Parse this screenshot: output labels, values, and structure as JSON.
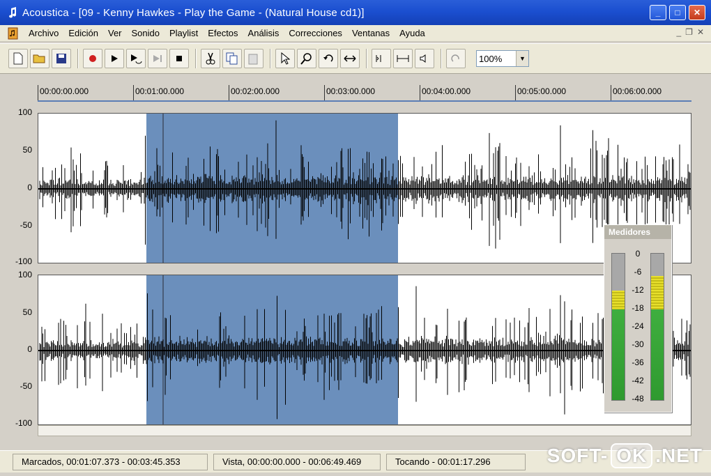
{
  "window": {
    "title": "Acoustica - [09 - Kenny Hawkes - Play the Game - (Natural House cd1)]",
    "controls": [
      "_",
      "□",
      "✕"
    ]
  },
  "menu": {
    "items": [
      "Archivo",
      "Edición",
      "Ver",
      "Sonido",
      "Playlist",
      "Efectos",
      "Análisis",
      "Correcciones",
      "Ventanas",
      "Ayuda"
    ]
  },
  "toolbar": {
    "buttons": [
      {
        "icon": "new-file-icon"
      },
      {
        "icon": "open-folder-icon"
      },
      {
        "icon": "save-icon"
      },
      {
        "icon": "record-icon"
      },
      {
        "icon": "play-icon"
      },
      {
        "icon": "play-loop-icon"
      },
      {
        "icon": "play-selection-icon"
      },
      {
        "icon": "stop-icon"
      },
      {
        "icon": "cut-icon"
      },
      {
        "icon": "copy-icon"
      },
      {
        "icon": "paste-icon"
      },
      {
        "icon": "select-arrow-icon"
      },
      {
        "icon": "zoom-magnifier-icon"
      },
      {
        "icon": "undo-icon"
      },
      {
        "icon": "fit-horizontal-icon"
      },
      {
        "icon": "zoom-selection-icon"
      },
      {
        "icon": "zoom-full-icon"
      },
      {
        "icon": "speaker-icon"
      },
      {
        "icon": "redo-icon"
      }
    ],
    "zoom_value": "100%"
  },
  "timeline": {
    "labels": [
      "00:00:00.000",
      "00:01:00.000",
      "00:02:00.000",
      "00:03:00.000",
      "00:04:00.000",
      "00:05:00.000",
      "00:06:00.000"
    ]
  },
  "tracks": {
    "y_labels": [
      "100",
      "50",
      "0",
      "-50",
      "-100"
    ],
    "selection_start_fraction": 0.165,
    "selection_end_fraction": 0.55,
    "cursor_fraction": 0.19,
    "waveform_color": "#000000",
    "selection_color": "#6b8fbc"
  },
  "meters": {
    "title": "Medidores",
    "scale": [
      "0",
      "-6",
      "-12",
      "-18",
      "-24",
      "-30",
      "-36",
      "-42",
      "-48"
    ],
    "left_level_fraction": 0.62,
    "right_level_fraction": 0.62,
    "left_peak_fraction": 0.75,
    "right_peak_fraction": 0.85
  },
  "status": {
    "marked": "Marcados, 00:01:07.373 - 00:03:45.353",
    "view": "Vista, 00:00:00.000 - 00:06:49.469",
    "playing": "Tocando - 00:01:17.296"
  },
  "watermark": {
    "left": "SOFT-",
    "mid": "OK",
    "right": ".NET"
  }
}
